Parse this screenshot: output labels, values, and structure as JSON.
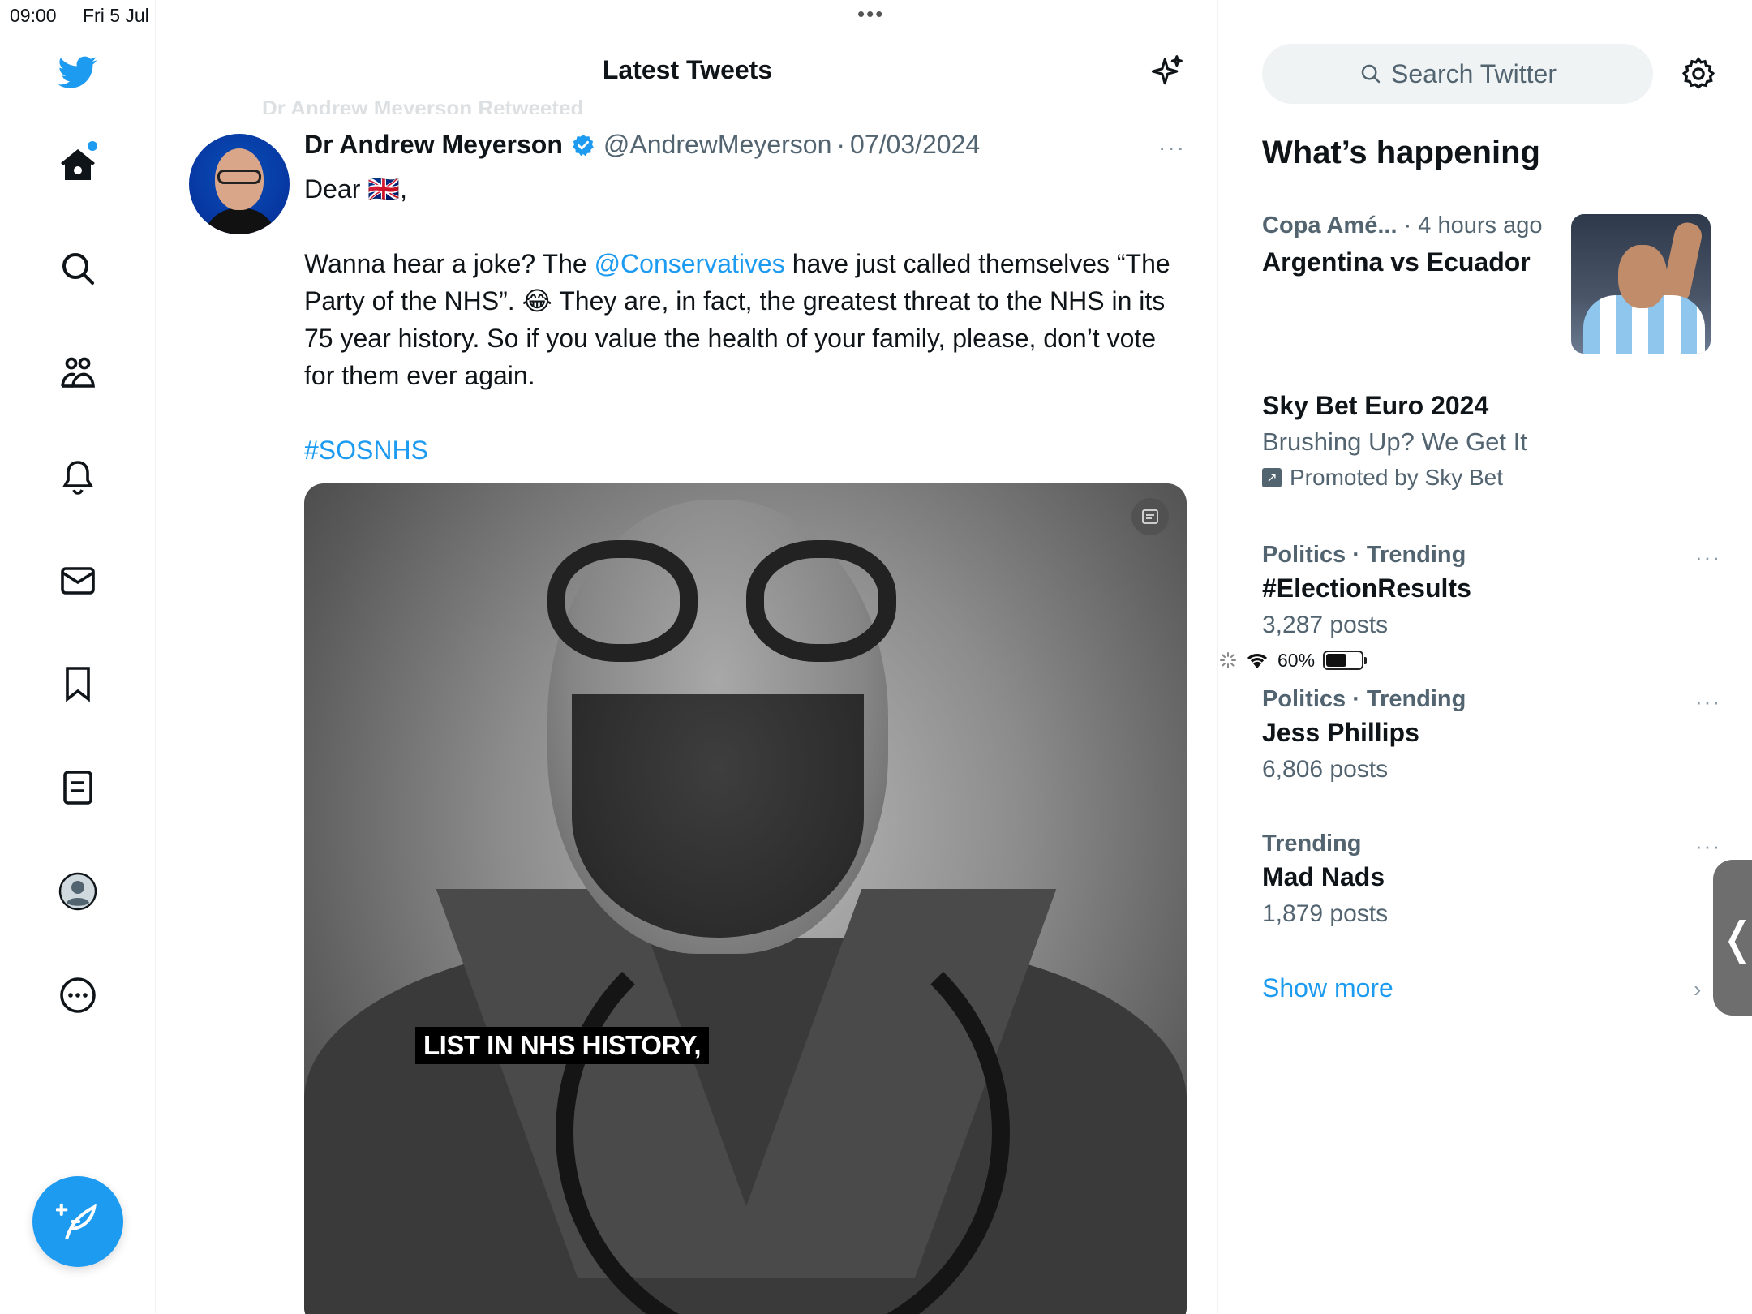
{
  "status_bar": {
    "time": "09:00",
    "date": "Fri 5 Jul",
    "battery": "60%",
    "battery_level": 0.6
  },
  "header": {
    "title": "Latest Tweets"
  },
  "nav": {
    "items": [
      "home-icon",
      "search-icon",
      "communities-icon",
      "notifications-icon",
      "messages-icon",
      "bookmarks-icon",
      "lists-icon",
      "profile-icon",
      "more-icon"
    ],
    "accent": "#1d9bf0"
  },
  "tweet": {
    "retweet_context": "Dr Andrew Meyerson Retweeted",
    "name": "Dr Andrew Meyerson",
    "handle": "@AndrewMeyerson",
    "separator": "·",
    "date": "07/03/2024",
    "more": "···",
    "greeting": "Dear 🇬🇧,",
    "text_before_mention": "Wanna hear a joke? The ",
    "mention": "@Conservatives",
    "text_after_mention": " have just called themselves “The Party of the NHS”. 😂 They are, in fact, the greatest threat to the NHS in its 75 year history. So if you value the health of your family, please, don’t vote for them ever again.",
    "hashtag": "#SOSNHS",
    "media_caption": "LIST IN NHS HISTORY,"
  },
  "sidebar": {
    "search_placeholder": "Search Twitter",
    "whats_happening": "What’s happening",
    "trends": [
      {
        "context": "Copa Amé...",
        "context_extra": " · 4 hours ago",
        "title": "Argentina vs Ecuador"
      },
      {
        "title": "Sky Bet Euro 2024",
        "subtitle": "Brushing Up? We Get It",
        "promoted": "Promoted by Sky Bet"
      },
      {
        "category": "Politics",
        "context": "Politics · Trending",
        "title": "#ElectionResults",
        "posts": "3,287 posts"
      },
      {
        "category": "Politics",
        "context": "Politics · Trending",
        "title": "Jess Phillips",
        "posts": "6,806 posts"
      },
      {
        "context": "Trending",
        "title": "Mad Nads",
        "posts": "1,879 posts"
      }
    ],
    "show_more": "Show more",
    "more_dots": "···"
  }
}
